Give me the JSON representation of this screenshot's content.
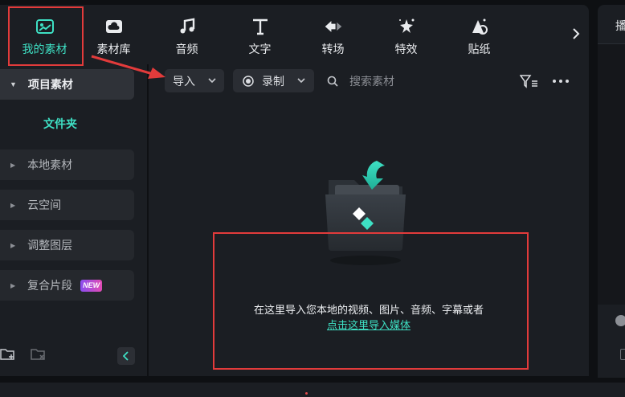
{
  "tabs": [
    {
      "label": "我的素材",
      "icon": "my-media-icon",
      "active": true
    },
    {
      "label": "素材库",
      "icon": "cloud-library-icon"
    },
    {
      "label": "音频",
      "icon": "music-note-icon"
    },
    {
      "label": "文字",
      "icon": "text-t-icon"
    },
    {
      "label": "转场",
      "icon": "transition-icon"
    },
    {
      "label": "特效",
      "icon": "sparkle-effect-icon"
    },
    {
      "label": "贴纸",
      "icon": "sticker-icon"
    }
  ],
  "right_panel": {
    "tab_label": "播"
  },
  "sidebar": {
    "header": "项目素材",
    "folder": "文件夹",
    "items": [
      {
        "label": "本地素材"
      },
      {
        "label": "云空间"
      },
      {
        "label": "调整图层"
      },
      {
        "label": "复合片段",
        "badge": "NEW"
      }
    ]
  },
  "toolbar": {
    "import_label": "导入",
    "record_label": "录制",
    "search_placeholder": "搜索素材"
  },
  "empty_state": {
    "message": "在这里导入您本地的视频、图片、音频、字幕或者",
    "link": "点击这里导入媒体"
  },
  "colors": {
    "accent": "#3ee0c4",
    "highlight": "#e23b3b",
    "badge_gradient": [
      "#8a4df0",
      "#e24bb4"
    ]
  }
}
